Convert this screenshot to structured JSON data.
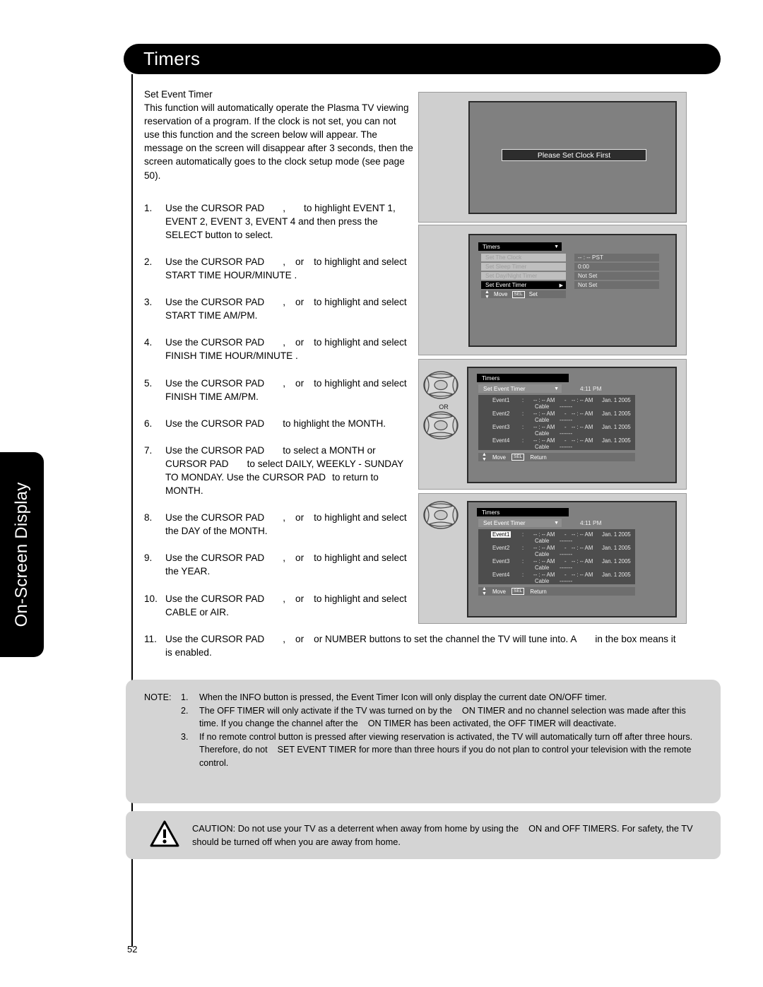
{
  "side_tab": {
    "label": "On-Screen Display"
  },
  "header": {
    "title": "Timers"
  },
  "intro": {
    "heading": "Set Event Timer",
    "body": "This function will automatically operate the Plasma TV viewing reservation of a program. If the clock is not set, you can not use this function and the screen below will appear. The message on the screen will disappear after 3 seconds, then the screen automatically goes to the clock setup mode (see page 50)."
  },
  "steps": [
    {
      "num": "1.",
      "a": "Use the CURSOR PAD",
      "b": ",",
      "c": "to highlight EVENT 1, EVENT 2, EVENT 3, EVENT 4 and then press the SELECT button to select."
    },
    {
      "num": "2.",
      "a": "Use the CURSOR PAD",
      "b": ",",
      "c": "or",
      "d": "to highlight and select START TIME HOUR/MINUTE ."
    },
    {
      "num": "3.",
      "a": "Use the CURSOR PAD",
      "b": ",",
      "c": "or",
      "d": "to highlight and select START TIME AM/PM."
    },
    {
      "num": "4.",
      "a": "Use the CURSOR PAD",
      "b": ",",
      "c": "or",
      "d": "to highlight and select FINISH TIME HOUR/MINUTE ."
    },
    {
      "num": "5.",
      "a": "Use the CURSOR PAD",
      "b": ",",
      "c": "or",
      "d": "to highlight and select FINISH TIME AM/PM."
    },
    {
      "num": "6.",
      "a": "Use the CURSOR PAD",
      "c": "to highlight the MONTH."
    },
    {
      "num": "7.",
      "a": "Use the CURSOR PAD",
      "c": "to select a MONTH  or CURSOR PAD",
      "d": "to select DAILY,  WEEKLY - SUNDAY TO MONDAY. Use the CURSOR PAD",
      "e": "to return to  MONTH."
    },
    {
      "num": "8.",
      "a": "Use the CURSOR PAD",
      "b": ",",
      "c": "or",
      "d": "to highlight and select the DAY of the MONTH."
    },
    {
      "num": "9.",
      "a": "Use the CURSOR PAD",
      "b": ",",
      "c": "or",
      "d": "to highlight and select the YEAR."
    },
    {
      "num": "10.",
      "a": "Use the CURSOR PAD",
      "b": ",",
      "c": "or",
      "d": "to highlight and select CABLE or AIR."
    },
    {
      "num": "11.",
      "a": "Use the CURSOR PAD",
      "b": ",",
      "c": "or",
      "d": "or NUMBER buttons to set the channel the TV will tune into. A",
      "e": "in the box means it is enabled."
    }
  ],
  "panel1": {
    "message": "Please Set Clock First"
  },
  "panel2": {
    "osd_title": "Timers",
    "caret": "▼",
    "menu": [
      {
        "label": "Set The Clock",
        "state": "dim"
      },
      {
        "label": "Set Sleep Timer",
        "state": "dim"
      },
      {
        "label": "Set Day/Night Timer",
        "state": "dim"
      },
      {
        "label": "Set Event Timer",
        "state": "sel",
        "arrow": "▶"
      }
    ],
    "values": [
      "-- : --  PST",
      "0:00",
      "Not Set",
      "Not Set"
    ],
    "footer": {
      "move": "Move",
      "sel": "SEL",
      "action": "Set"
    }
  },
  "event_panels": {
    "or_label": "OR",
    "title": "Timers",
    "subtitle": "Set Event Timer",
    "caret": "▼",
    "clock": "4:11 PM",
    "columns": {
      "colon": ":",
      "dash": "-",
      "source": "Cable",
      "source_value": "-------"
    },
    "rows": [
      {
        "name": "Event1",
        "start": "-- : -- AM",
        "end": "-- : -- AM",
        "date": "Jan. 1 2005"
      },
      {
        "name": "Event2",
        "start": "-- : -- AM",
        "end": "-- : -- AM",
        "date": "Jan. 1 2005"
      },
      {
        "name": "Event3",
        "start": "-- : -- AM",
        "end": "-- : -- AM",
        "date": "Jan. 1 2005"
      },
      {
        "name": "Event4",
        "start": "-- : -- AM",
        "end": "-- : -- AM",
        "date": "Jan. 1 2005"
      }
    ],
    "footer": {
      "move": "Move",
      "sel": "SEL",
      "action": "Return"
    },
    "highlight_row": "Event1"
  },
  "note": {
    "label": "NOTE:",
    "items": [
      {
        "n": "1.",
        "text": "When the INFO button is pressed, the Event Timer Icon will only display the current date ON/OFF timer."
      },
      {
        "n": "2.",
        "text_a": "The OFF TIMER will only activate if the TV was turned on by the",
        "text_b": "ON TIMER and no channel selection was made after this time. If you change the channel after the",
        "text_c": "ON TIMER has been activated, the OFF TIMER  will deactivate."
      },
      {
        "n": "3.",
        "text_a": "If no remote control button is pressed after viewing reservation is activated, the TV will automatically turn off after three hours. Therefore, do not",
        "text_b": "SET EVENT TIMER for more than three hours if you do not plan to control your television with the remote control."
      }
    ]
  },
  "caution": {
    "text_a": "CAUTION:  Do not use your TV as a deterrent when away from home by using the",
    "text_b": "ON and OFF TIMERS. For safety, the TV should be turned off when you are away from home."
  },
  "page_number": "52",
  "colors": {
    "header_bg": "#000000",
    "panel_bg": "#cfcfcf",
    "tv_bg": "#808080",
    "note_bg": "#d4d4d4",
    "osd_value_bg": "#6e6e6e",
    "osd_table_bg": "#4d4d4d"
  }
}
